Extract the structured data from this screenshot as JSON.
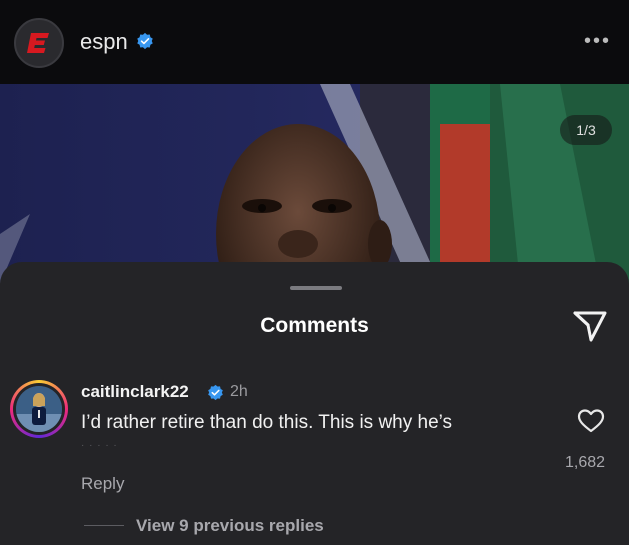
{
  "header": {
    "username": "espn",
    "logo_letter": "E",
    "more_label": "•••"
  },
  "photo": {
    "counter": "1/3"
  },
  "comments_sheet": {
    "title": "Comments",
    "comment": {
      "username": "caitlinclark22",
      "time": "2h",
      "text": "I’d rather retire than do this. This is why he’s",
      "likes": "1,682",
      "reply_label": "Reply",
      "view_replies": "View 9 previous replies"
    }
  },
  "colors": {
    "verified": "#3897f0",
    "espn_red": "#d71920",
    "sheet_bg": "#242427"
  },
  "icons": [
    "espn-logo-icon",
    "verified-icon",
    "more-icon",
    "share-icon",
    "heart-icon"
  ]
}
